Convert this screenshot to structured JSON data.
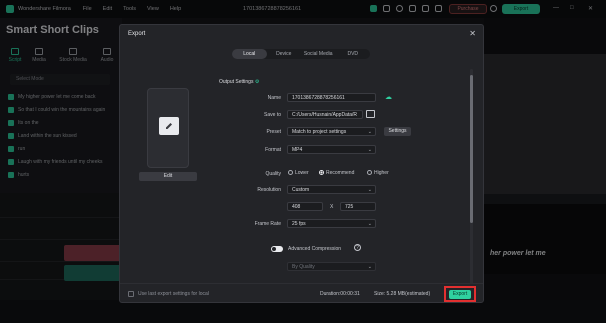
{
  "app": {
    "name": "Wondershare Filmora",
    "menus": [
      "File",
      "Edit",
      "Tools",
      "View",
      "Help"
    ],
    "project_title": "1701386728878256161",
    "purchase_label": "Purchase",
    "export_label": "Export"
  },
  "left_panel": {
    "title": "Smart Short Clips",
    "tabs": [
      "Script",
      "Media",
      "Stock Media",
      "Audio"
    ],
    "mode_placeholder": "Select Mode",
    "clips": [
      "My higher power let me come back",
      "So that I could win the mountains again",
      "Its on the",
      "Land within the sun kissed",
      "run",
      "Laugh with my friends until my cheeks",
      "hurts"
    ]
  },
  "preview": {
    "caption": "her power let me"
  },
  "dialog": {
    "title": "Export",
    "tabs": [
      "Local",
      "Device",
      "Social Media",
      "DVD"
    ],
    "active_tab": "Local",
    "edit_label": "Edit",
    "section_title": "Output Settings",
    "fields": {
      "name_label": "Name",
      "name_value": "1701386728878256161",
      "save_to_label": "Save to",
      "save_to_value": "C:/Users/Husnain/AppData/R",
      "preset_label": "Preset",
      "preset_value": "Match to project settings",
      "settings_label": "Settings",
      "format_label": "Format",
      "format_value": "MP4",
      "quality_label": "Quality",
      "quality_options": [
        "Lower",
        "Recommend",
        "Higher"
      ],
      "quality_selected": "Recommend",
      "resolution_label": "Resolution",
      "resolution_value": "Custom",
      "width_value": "408",
      "x_label": "X",
      "height_value": "725",
      "frame_rate_label": "Frame Rate",
      "frame_rate_value": "25 fps",
      "advanced_label": "Advanced Compression",
      "advanced_value": "By Quality"
    },
    "footer": {
      "default_label": "Use last export settings for local",
      "duration": "Duration:00:00:31",
      "size": "Size: 5.28 MB(estimated)",
      "export_label": "Export"
    }
  },
  "colors": {
    "accent": "#2fd0a0",
    "highlight": "#e23030"
  }
}
